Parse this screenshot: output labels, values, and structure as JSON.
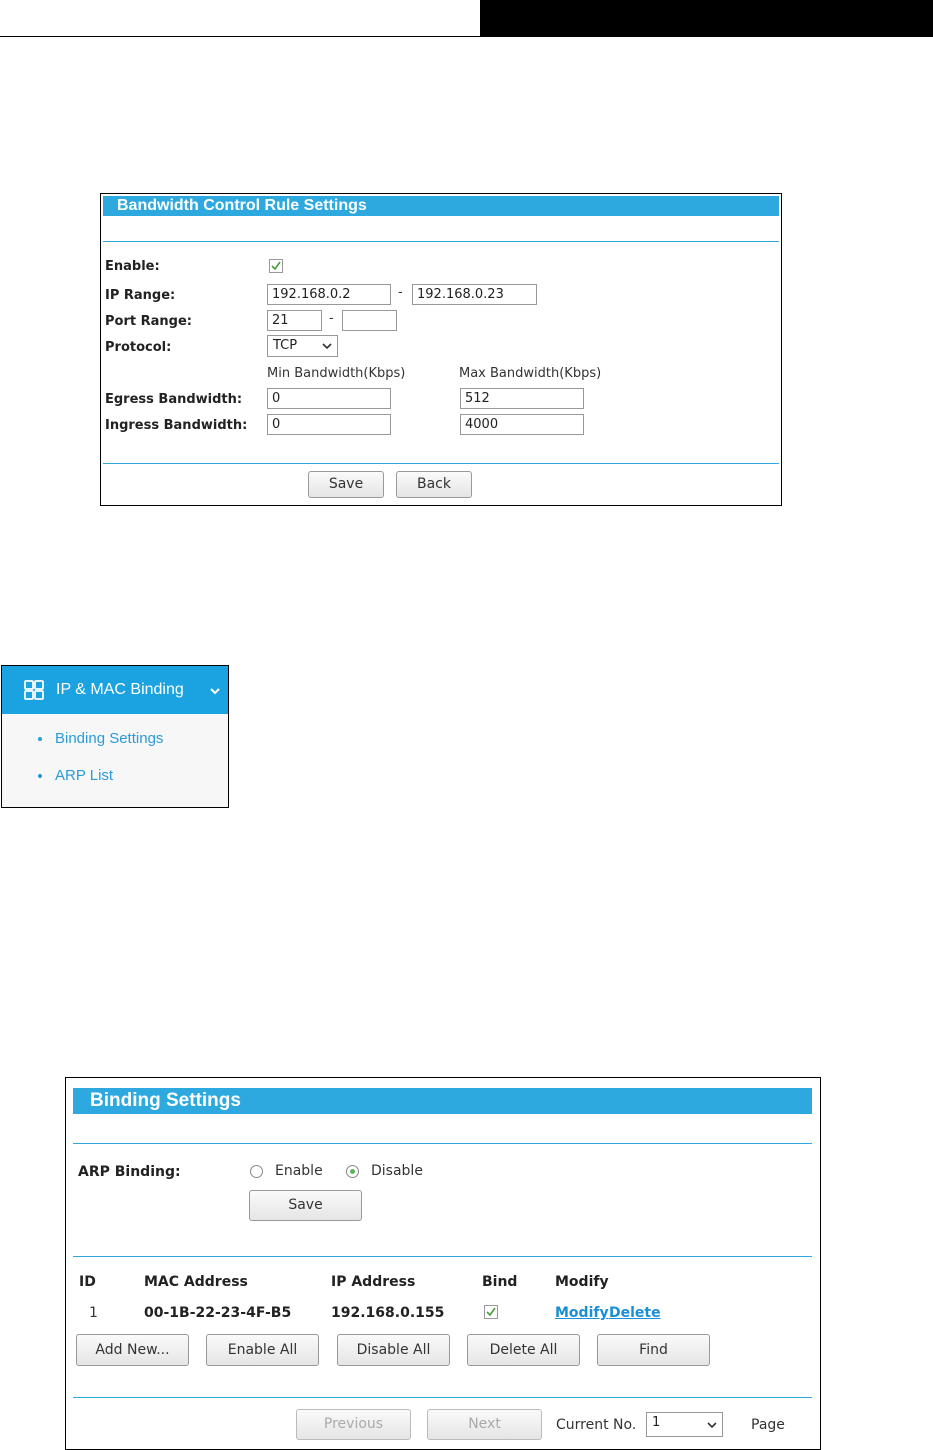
{
  "bandwidth": {
    "title": "Bandwidth Control Rule Settings",
    "enable_label": "Enable:",
    "ip_range_label": "IP Range:",
    "ip_start": "192.168.0.2",
    "ip_end": "192.168.0.23",
    "range_dash": "-",
    "port_range_label": "Port Range:",
    "port_start": "21",
    "port_end": "",
    "protocol_label": "Protocol:",
    "protocol_value": "TCP",
    "min_bw_header": "Min Bandwidth(Kbps)",
    "max_bw_header": "Max Bandwidth(Kbps)",
    "egress_label": "Egress Bandwidth:",
    "egress_min": "0",
    "egress_max": "512",
    "ingress_label": "Ingress Bandwidth:",
    "ingress_min": "0",
    "ingress_max": "4000",
    "save_label": "Save",
    "back_label": "Back"
  },
  "menu": {
    "title": "IP & MAC Binding",
    "items": [
      {
        "label": "Binding Settings"
      },
      {
        "label": "ARP List"
      }
    ]
  },
  "binding": {
    "title": "Binding Settings",
    "arp_label": "ARP Binding:",
    "enable_label": "Enable",
    "disable_label": "Disable",
    "selected": "Disable",
    "save_label": "Save",
    "columns": [
      "ID",
      "MAC Address",
      "IP Address",
      "Bind",
      "Modify"
    ],
    "rows": [
      {
        "id": "1",
        "mac": "00-1B-22-23-4F-B5",
        "ip": "192.168.0.155",
        "bind": true,
        "modify": "Modify",
        "delete": "Delete"
      }
    ],
    "buttons": {
      "add_new": "Add New...",
      "enable_all": "Enable All",
      "disable_all": "Disable All",
      "delete_all": "Delete All",
      "find": "Find"
    },
    "pager": {
      "previous": "Previous",
      "next": "Next",
      "current_label": "Current No.",
      "current_value": "1",
      "page_label": "Page"
    }
  },
  "colors": {
    "accent": "#2ea9e0",
    "menu_accent": "#1aa3e0",
    "link": "#1a8fd6"
  }
}
